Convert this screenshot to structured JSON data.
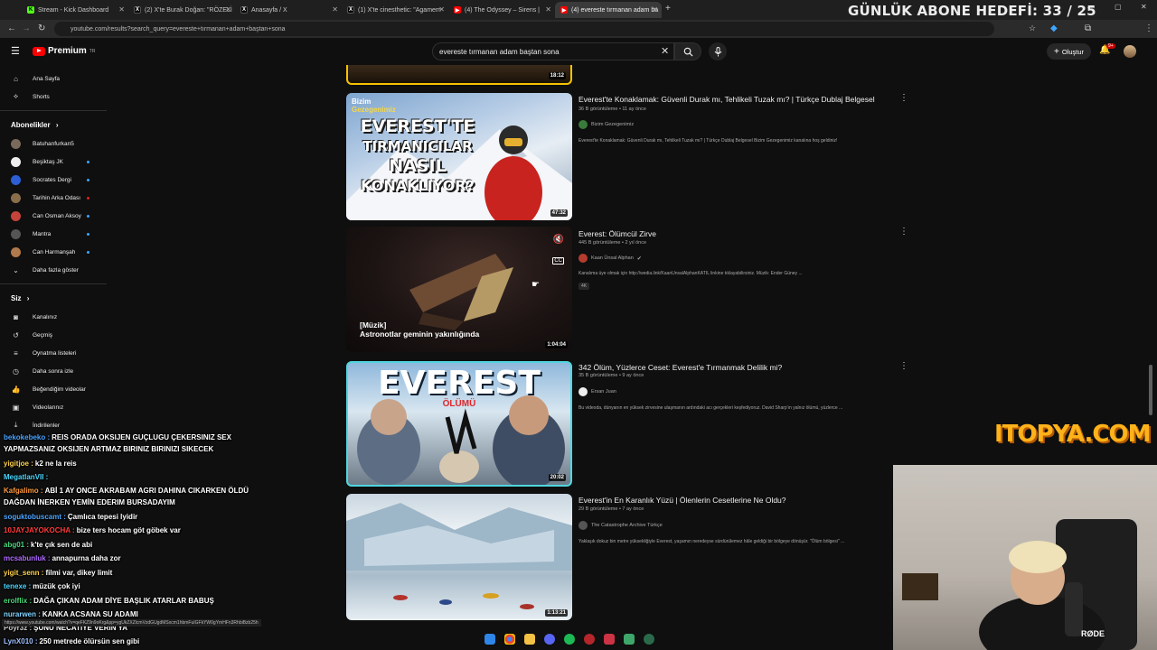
{
  "browser": {
    "tabs": [
      {
        "title": "Stream - Kick Dashboard",
        "favicon_color": "#53fc18",
        "favicon": "K"
      },
      {
        "title": "(2) X'te Burak Doğan: \"RÖZELİ",
        "favicon_color": "#000000",
        "favicon": "X"
      },
      {
        "title": "Anasayfa / X",
        "favicon_color": "#000000",
        "favicon": "X"
      },
      {
        "title": "(1) X'te cinesthetic: \"Agamem",
        "favicon_color": "#000000",
        "favicon": "X"
      },
      {
        "title": "(4) The Odyssey – Sirens |",
        "favicon_color": "#ff0000",
        "favicon": "▶"
      },
      {
        "title": "(4) evereste tırmanan adam ba",
        "favicon_color": "#ff0000",
        "favicon": "▶"
      }
    ],
    "url": "youtube.com/results?search_query=evereste+tırmanan+adam+baştan+sona"
  },
  "overlay": {
    "goal": "GÜNLÜK ABONE HEDEFİ: 33 / 25",
    "sponsor": "ITOPYA.COM"
  },
  "youtube": {
    "logo_text": "Premium",
    "logo_sup": "TR",
    "search_value": "evereste tırmanan adam baştan sona",
    "create_label": "Oluştur",
    "notification_count": "9+",
    "sidebar": {
      "top": [
        {
          "label": "Ana Sayfa",
          "icon": "home-icon"
        },
        {
          "label": "Shorts",
          "icon": "shorts-icon"
        }
      ],
      "subscriptions_title": "Abonelikler",
      "subscriptions": [
        {
          "label": "Batuhanfurkan5",
          "color": "#7a6a5a"
        },
        {
          "label": "Beşiktaş JK",
          "color": "#eeeeee"
        },
        {
          "label": "Socrates Dergi",
          "color": "#2c5fd6"
        },
        {
          "label": "Tarihin Arka Odası",
          "color": "#8a6d4a"
        },
        {
          "label": "Can Osman Aksoy",
          "color": "#c4433a"
        },
        {
          "label": "Mantra",
          "color": "#555555"
        },
        {
          "label": "Can Harmanşah",
          "color": "#b07a4d"
        }
      ],
      "show_more": "Daha fazla göster",
      "you_title": "Siz",
      "you": [
        {
          "label": "Kanalınız",
          "icon": "account-icon"
        },
        {
          "label": "Geçmiş",
          "icon": "history-icon"
        },
        {
          "label": "Oynatma listeleri",
          "icon": "playlist-icon"
        },
        {
          "label": "Daha sonra izle",
          "icon": "clock-icon"
        },
        {
          "label": "Beğendiğim videolar",
          "icon": "thumbs-up-icon"
        },
        {
          "label": "Videolarınız",
          "icon": "video-icon"
        },
        {
          "label": "İndirilenler",
          "icon": "download-icon"
        }
      ]
    },
    "results": [
      {
        "duration": "18:12"
      },
      {
        "title": "Everest'te Konaklamak: Güvenli Durak mı, Tehlikeli Tuzak mı? | Türkçe Dublaj Belgesel",
        "meta": "36 B görüntüleme • 11 ay önce",
        "channel": "Bizim Gezegenimiz",
        "description": "Everest'te Konaklamak: Güvenli Durak mı, Tehlikeli Tuzak mı? | Türkçe Dublaj Belgesel Bizim Gezegenimiz kanalına hoş geldiniz!",
        "duration": "47:32",
        "thumb_brand_1": "Bizim",
        "thumb_brand_2": "Gezegenimiz",
        "thumb_text": [
          "EVEREST'TE",
          "TIRMANICILAR",
          "NASIL",
          "KONAKLIYOR?"
        ]
      },
      {
        "title": "Everest: Ölümcül Zirve",
        "meta": "445 B görüntüleme • 2 yıl önce",
        "channel": "Kaan Ünsal Alphan",
        "description": "Kanalıma üye olmak için http://wedia.link/KaanUnsalAlphanKATIL linkine tıklayabilirsiniz. Müzik: Ender Güney ...",
        "badge": "4K",
        "duration": "1:04:04",
        "caption_line1": "[Müzik]",
        "caption_line2": "Astronotlar geminin yakınlığında"
      },
      {
        "title": "342 Ölüm, Yüzlerce Ceset: Everest'e Tırmanmak Delilik mi?",
        "meta": "35 B görüntüleme • 9 ay önce",
        "channel": "Ersan Juan",
        "description": "Bu videoda, dünyanın en yüksek zirvesine ulaşmanın ardındaki acı gerçekleri keşfediyoruz. David Sharp'ın yalnız ölümü, yüzlerce ...",
        "duration": "20:02",
        "thumb_text": "EVEREST",
        "thumb_sub": "ÖLÜMÜ"
      },
      {
        "title": "Everest'in En Karanlık Yüzü | Ölenlerin Cesetlerine Ne Oldu?",
        "meta": "29 B görüntüleme • 7 ay önce",
        "channel": "The Catastrophe Archive Türkçe",
        "description": "Yaklaşık dokuz bin metre yüksekliğiyle Everest, yaşamın neredeyse sürdürülemez hâle geldiği bir bölgeye dönüşür. \"Ölüm bölgesi\" ...",
        "duration": "1:13:21"
      }
    ]
  },
  "chat": [
    {
      "user": "bekokebeko",
      "color": "#4aa3ff",
      "text": "REIS ORADA OKSIJEN GUÇLUGU ÇEKERSINIZ SEX"
    },
    {
      "user": "",
      "color": "#ffffff",
      "text": "YAPMAZSANIZ OKSIJEN ARTMAZ BIRINIZ BIRINIZI SIKECEK"
    },
    {
      "user": "yigitjoe",
      "color": "#ffd24a",
      "text": "k2 ne la reis"
    },
    {
      "user": "MegatlanVII",
      "color": "#4ad6ff",
      "text": ""
    },
    {
      "user": "Kafgalimo",
      "color": "#ff9a3c",
      "text": "ABİ 1 AY ONCE AKRABAM AGRI DAHINA CIKARKEN ÖLDÜ"
    },
    {
      "user": "",
      "color": "#ffffff",
      "text": "DAĞDAN İNERKEN YEMİN EDERIM BURSADAYIM"
    },
    {
      "user": "soguktobuscamt",
      "color": "#4aa3ff",
      "text": "Çamlıca tepesi lyidir"
    },
    {
      "user": "10JAYJAYOKOCHA",
      "color": "#ff3b3b",
      "text": "bize ters hocam göt göbek var"
    },
    {
      "user": "abg01",
      "color": "#4ad67a",
      "text": "k'te çık sen de abi"
    },
    {
      "user": "mcsabunluk",
      "color": "#b06bff",
      "text": "annapurna daha zor"
    },
    {
      "user": "yigit_senn",
      "color": "#ffd24a",
      "text": "filmi var, dikey limit"
    },
    {
      "user": "tenexe",
      "color": "#4ad6ff",
      "text": "müzük çok iyi"
    },
    {
      "user": "erolflix",
      "color": "#4ad67a",
      "text": "DAĞA ÇIKAN ADAM DİYE BAŞLIK ATARLAR BABUŞ"
    },
    {
      "user": "nurarwen",
      "color": "#7fd4ff",
      "text": "KANKA ACSANA SU ADAMI"
    },
    {
      "user": "Poyr3z",
      "color": "#cccccc",
      "text": "ŞUNU NECATİYE VERİN YA"
    },
    {
      "user": "LynX010",
      "color": "#9fc1ff",
      "text": "250 metrede ölürsün sen gibi"
    }
  ],
  "status_url": "https://www.youtube.com/watch?v=qeFKZ9n9oKrg&pp=ygUkZXZlcmVzdGUgdMSxcm1hbmFuIGFkYW0gYmHFn3RhbiBzb25h"
}
